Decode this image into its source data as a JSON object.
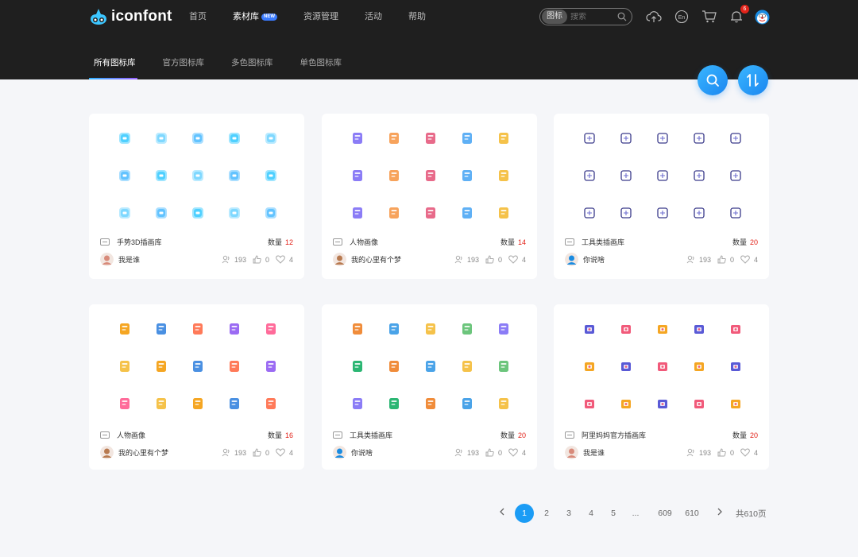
{
  "header": {
    "logo_text": "iconfont",
    "nav": [
      {
        "label": "首页"
      },
      {
        "label": "素材库",
        "badge": "NEW"
      },
      {
        "label": "资源管理"
      },
      {
        "label": "活动"
      },
      {
        "label": "帮助"
      }
    ],
    "search": {
      "type_label": "图标",
      "placeholder": "搜索"
    },
    "notification_count": "6",
    "icons": [
      "upload-icon",
      "language-en-icon",
      "cart-icon",
      "bell-icon",
      "user-avatar"
    ]
  },
  "subnav": {
    "tabs": [
      {
        "label": "所有图标库"
      },
      {
        "label": "官方图标库"
      },
      {
        "label": "多色图标库"
      },
      {
        "label": "单色图标库"
      }
    ]
  },
  "fabs": [
    "search-icon",
    "sort-icon"
  ],
  "cards": [
    {
      "title": "手势3D插画库",
      "count_label": "数量",
      "count": "12",
      "author": "我是谁",
      "stats": {
        "collect": "193",
        "like": "0",
        "fav": "4"
      }
    },
    {
      "title": "人物画像",
      "count_label": "数量",
      "count": "14",
      "author": "我的心里有个梦",
      "stats": {
        "collect": "193",
        "like": "0",
        "fav": "4"
      }
    },
    {
      "title": "工具类插画库",
      "count_label": "数量",
      "count": "20",
      "author": "你说啥",
      "stats": {
        "collect": "193",
        "like": "0",
        "fav": "4"
      }
    },
    {
      "title": "人物画像",
      "count_label": "数量",
      "count": "16",
      "author": "我的心里有个梦",
      "stats": {
        "collect": "193",
        "like": "0",
        "fav": "4"
      }
    },
    {
      "title": "工具类插画库",
      "count_label": "数量",
      "count": "20",
      "author": "你说啥",
      "stats": {
        "collect": "193",
        "like": "0",
        "fav": "4"
      }
    },
    {
      "title": "阿里妈妈官方插画库",
      "count_label": "数量",
      "count": "20",
      "author": "我是谁",
      "stats": {
        "collect": "193",
        "like": "0",
        "fav": "4"
      }
    }
  ],
  "pagination": {
    "pages": [
      "1",
      "2",
      "3",
      "4",
      "5",
      "...",
      "609",
      "610"
    ],
    "current": "1",
    "total_label": "共610页"
  },
  "colors": {
    "accent": "#1b9cf5",
    "header_bg": "#1f1f1f",
    "count_red": "#e2231a"
  }
}
